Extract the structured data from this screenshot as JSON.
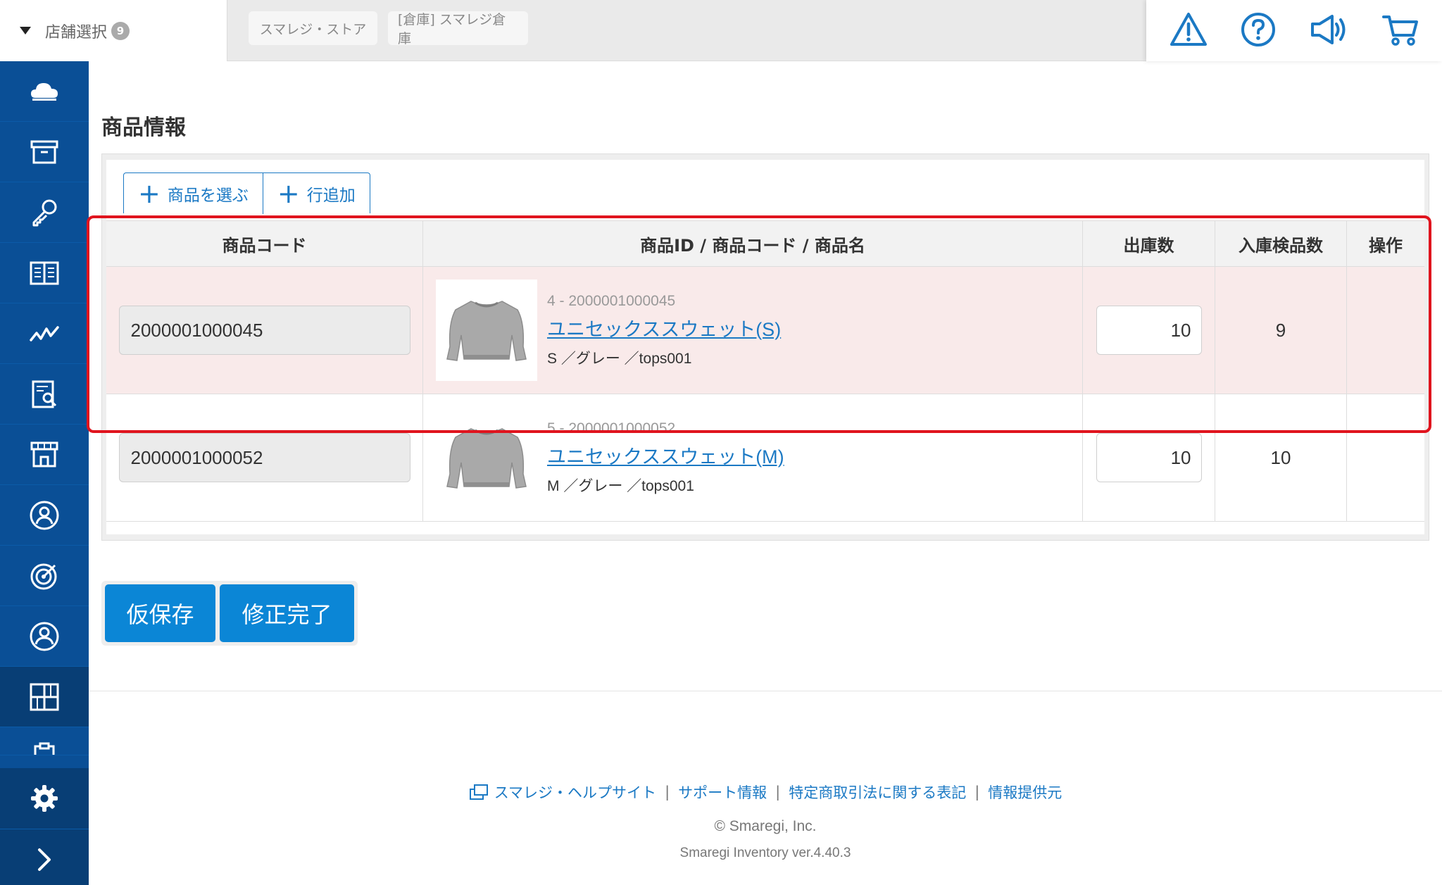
{
  "header": {
    "store_select_label": "店舗選択",
    "store_count": "9",
    "chips": [
      "スマレジ・ストア",
      "[倉庫] スマレジ倉庫"
    ]
  },
  "page_title": "商品情報",
  "actions": {
    "select_products": "商品を選ぶ",
    "add_row": "行追加"
  },
  "table": {
    "headers": [
      "商品コード",
      "商品ID / 商品コード / 商品名",
      "出庫数",
      "入庫検品数",
      "操作"
    ],
    "rows": [
      {
        "code": "2000001000045",
        "id_line": "4 - 2000001000045",
        "name": "ユニセックススウェット(S)",
        "meta": "S ／グレー ／tops001",
        "ship_qty": "10",
        "inspect_qty": "9"
      },
      {
        "code": "2000001000052",
        "id_line": "5 - 2000001000052",
        "name": "ユニセックススウェット(M)",
        "meta": "M ／グレー ／tops001",
        "ship_qty": "10",
        "inspect_qty": "10"
      }
    ]
  },
  "buttons": {
    "save_draft": "仮保存",
    "complete": "修正完了"
  },
  "footer": {
    "links": [
      "スマレジ・ヘルプサイト",
      "サポート情報",
      "特定商取引法に関する表記",
      "情報提供元"
    ],
    "separator": "|",
    "copyright": "© Smaregi, Inc.",
    "version": "Smaregi Inventory ver.4.40.3"
  },
  "colors": {
    "sidebar": "#0a4f96",
    "primary": "#0b86d6",
    "link": "#1b79c4",
    "highlight_row": "#f9eaea",
    "highlight_frame": "#e0141e"
  },
  "icons": {
    "top": [
      "warning-icon",
      "help-icon",
      "announcement-icon",
      "cart-icon"
    ],
    "sidebar": [
      "cloud-icon",
      "archive-icon",
      "key-icon",
      "book-icon",
      "chart-line-icon",
      "report-search-icon",
      "store-icon",
      "person-circle-icon",
      "target-icon",
      "user-circle-icon",
      "grid-icon",
      "clipboard-icon",
      "gear-icon",
      "chevron-right-icon"
    ]
  }
}
